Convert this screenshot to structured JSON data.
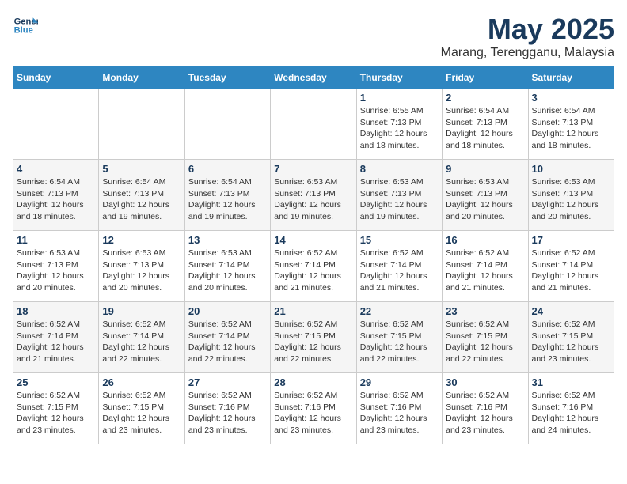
{
  "logo": {
    "line1": "General",
    "line2": "Blue"
  },
  "title": "May 2025",
  "location": "Marang, Terengganu, Malaysia",
  "days_header": [
    "Sunday",
    "Monday",
    "Tuesday",
    "Wednesday",
    "Thursday",
    "Friday",
    "Saturday"
  ],
  "weeks": [
    [
      {
        "day": "",
        "text": ""
      },
      {
        "day": "",
        "text": ""
      },
      {
        "day": "",
        "text": ""
      },
      {
        "day": "",
        "text": ""
      },
      {
        "day": "1",
        "text": "Sunrise: 6:55 AM\nSunset: 7:13 PM\nDaylight: 12 hours\nand 18 minutes."
      },
      {
        "day": "2",
        "text": "Sunrise: 6:54 AM\nSunset: 7:13 PM\nDaylight: 12 hours\nand 18 minutes."
      },
      {
        "day": "3",
        "text": "Sunrise: 6:54 AM\nSunset: 7:13 PM\nDaylight: 12 hours\nand 18 minutes."
      }
    ],
    [
      {
        "day": "4",
        "text": "Sunrise: 6:54 AM\nSunset: 7:13 PM\nDaylight: 12 hours\nand 18 minutes."
      },
      {
        "day": "5",
        "text": "Sunrise: 6:54 AM\nSunset: 7:13 PM\nDaylight: 12 hours\nand 19 minutes."
      },
      {
        "day": "6",
        "text": "Sunrise: 6:54 AM\nSunset: 7:13 PM\nDaylight: 12 hours\nand 19 minutes."
      },
      {
        "day": "7",
        "text": "Sunrise: 6:53 AM\nSunset: 7:13 PM\nDaylight: 12 hours\nand 19 minutes."
      },
      {
        "day": "8",
        "text": "Sunrise: 6:53 AM\nSunset: 7:13 PM\nDaylight: 12 hours\nand 19 minutes."
      },
      {
        "day": "9",
        "text": "Sunrise: 6:53 AM\nSunset: 7:13 PM\nDaylight: 12 hours\nand 20 minutes."
      },
      {
        "day": "10",
        "text": "Sunrise: 6:53 AM\nSunset: 7:13 PM\nDaylight: 12 hours\nand 20 minutes."
      }
    ],
    [
      {
        "day": "11",
        "text": "Sunrise: 6:53 AM\nSunset: 7:13 PM\nDaylight: 12 hours\nand 20 minutes."
      },
      {
        "day": "12",
        "text": "Sunrise: 6:53 AM\nSunset: 7:13 PM\nDaylight: 12 hours\nand 20 minutes."
      },
      {
        "day": "13",
        "text": "Sunrise: 6:53 AM\nSunset: 7:14 PM\nDaylight: 12 hours\nand 20 minutes."
      },
      {
        "day": "14",
        "text": "Sunrise: 6:52 AM\nSunset: 7:14 PM\nDaylight: 12 hours\nand 21 minutes."
      },
      {
        "day": "15",
        "text": "Sunrise: 6:52 AM\nSunset: 7:14 PM\nDaylight: 12 hours\nand 21 minutes."
      },
      {
        "day": "16",
        "text": "Sunrise: 6:52 AM\nSunset: 7:14 PM\nDaylight: 12 hours\nand 21 minutes."
      },
      {
        "day": "17",
        "text": "Sunrise: 6:52 AM\nSunset: 7:14 PM\nDaylight: 12 hours\nand 21 minutes."
      }
    ],
    [
      {
        "day": "18",
        "text": "Sunrise: 6:52 AM\nSunset: 7:14 PM\nDaylight: 12 hours\nand 21 minutes."
      },
      {
        "day": "19",
        "text": "Sunrise: 6:52 AM\nSunset: 7:14 PM\nDaylight: 12 hours\nand 22 minutes."
      },
      {
        "day": "20",
        "text": "Sunrise: 6:52 AM\nSunset: 7:14 PM\nDaylight: 12 hours\nand 22 minutes."
      },
      {
        "day": "21",
        "text": "Sunrise: 6:52 AM\nSunset: 7:15 PM\nDaylight: 12 hours\nand 22 minutes."
      },
      {
        "day": "22",
        "text": "Sunrise: 6:52 AM\nSunset: 7:15 PM\nDaylight: 12 hours\nand 22 minutes."
      },
      {
        "day": "23",
        "text": "Sunrise: 6:52 AM\nSunset: 7:15 PM\nDaylight: 12 hours\nand 22 minutes."
      },
      {
        "day": "24",
        "text": "Sunrise: 6:52 AM\nSunset: 7:15 PM\nDaylight: 12 hours\nand 23 minutes."
      }
    ],
    [
      {
        "day": "25",
        "text": "Sunrise: 6:52 AM\nSunset: 7:15 PM\nDaylight: 12 hours\nand 23 minutes."
      },
      {
        "day": "26",
        "text": "Sunrise: 6:52 AM\nSunset: 7:15 PM\nDaylight: 12 hours\nand 23 minutes."
      },
      {
        "day": "27",
        "text": "Sunrise: 6:52 AM\nSunset: 7:16 PM\nDaylight: 12 hours\nand 23 minutes."
      },
      {
        "day": "28",
        "text": "Sunrise: 6:52 AM\nSunset: 7:16 PM\nDaylight: 12 hours\nand 23 minutes."
      },
      {
        "day": "29",
        "text": "Sunrise: 6:52 AM\nSunset: 7:16 PM\nDaylight: 12 hours\nand 23 minutes."
      },
      {
        "day": "30",
        "text": "Sunrise: 6:52 AM\nSunset: 7:16 PM\nDaylight: 12 hours\nand 23 minutes."
      },
      {
        "day": "31",
        "text": "Sunrise: 6:52 AM\nSunset: 7:16 PM\nDaylight: 12 hours\nand 24 minutes."
      }
    ]
  ]
}
